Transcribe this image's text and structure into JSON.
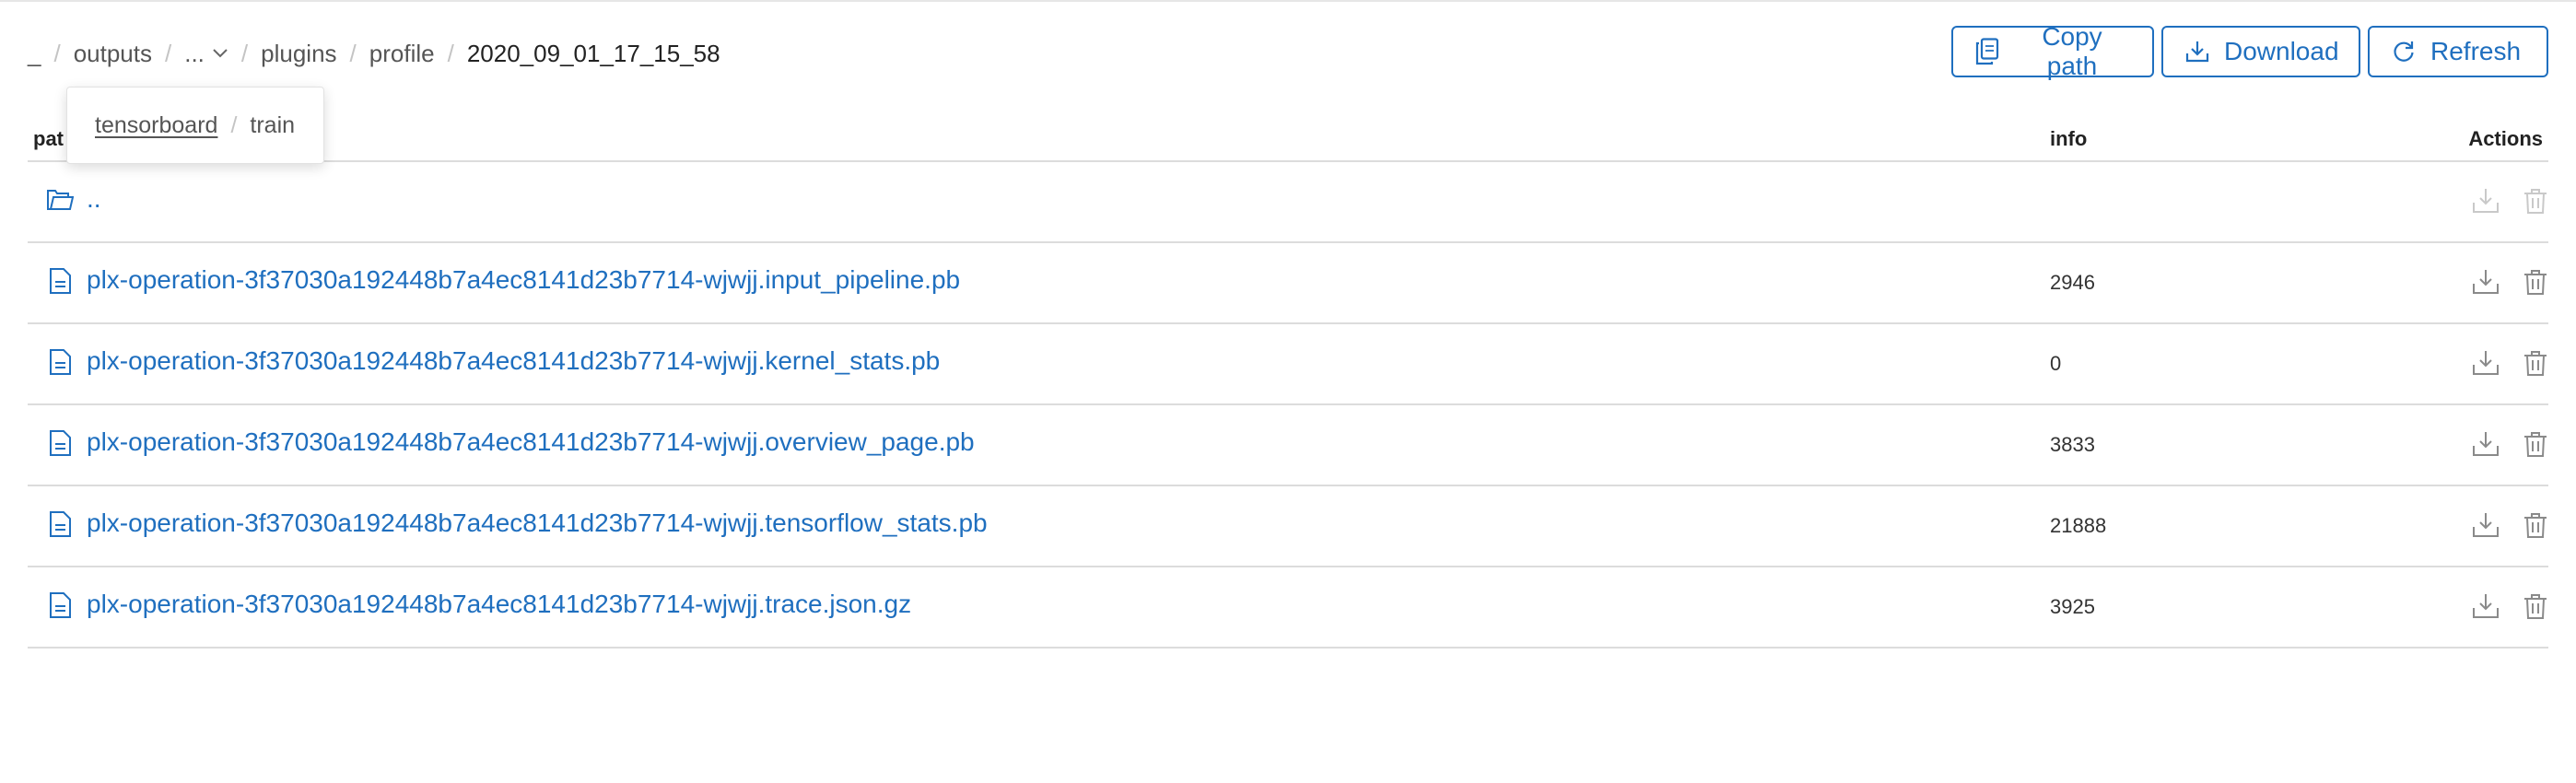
{
  "breadcrumb": {
    "root": "_",
    "outputs": "outputs",
    "ellipsis": "...",
    "plugins": "plugins",
    "profile": "profile",
    "current": "2020_09_01_17_15_58",
    "separator": "/"
  },
  "dropdown": {
    "items": [
      "tensorboard",
      "train"
    ]
  },
  "toolbar": {
    "copy_label": "Copy path",
    "download_label": "Download",
    "refresh_label": "Refresh"
  },
  "table": {
    "headers": {
      "path": "pat",
      "info": "info",
      "actions": "Actions"
    },
    "rows": [
      {
        "name": "..",
        "info": "",
        "type": "folder"
      },
      {
        "name": "plx-operation-3f37030a192448b7a4ec8141d23b7714-wjwjj.input_pipeline.pb",
        "info": "2946",
        "type": "file"
      },
      {
        "name": "plx-operation-3f37030a192448b7a4ec8141d23b7714-wjwjj.kernel_stats.pb",
        "info": "0",
        "type": "file"
      },
      {
        "name": "plx-operation-3f37030a192448b7a4ec8141d23b7714-wjwjj.overview_page.pb",
        "info": "3833",
        "type": "file"
      },
      {
        "name": "plx-operation-3f37030a192448b7a4ec8141d23b7714-wjwjj.tensorflow_stats.pb",
        "info": "21888",
        "type": "file"
      },
      {
        "name": "plx-operation-3f37030a192448b7a4ec8141d23b7714-wjwjj.trace.json.gz",
        "info": "3925",
        "type": "file"
      }
    ]
  },
  "colors": {
    "accent": "#1f6fbf",
    "border": "#dcdcdc",
    "icon_gray": "#8a8a8a"
  },
  "icons": {
    "copy": "copy-icon",
    "download": "download-icon",
    "refresh": "refresh-icon",
    "folder": "folder-icon",
    "file": "file-icon",
    "delete": "trash-icon",
    "chevron": "chevron-down-icon"
  }
}
